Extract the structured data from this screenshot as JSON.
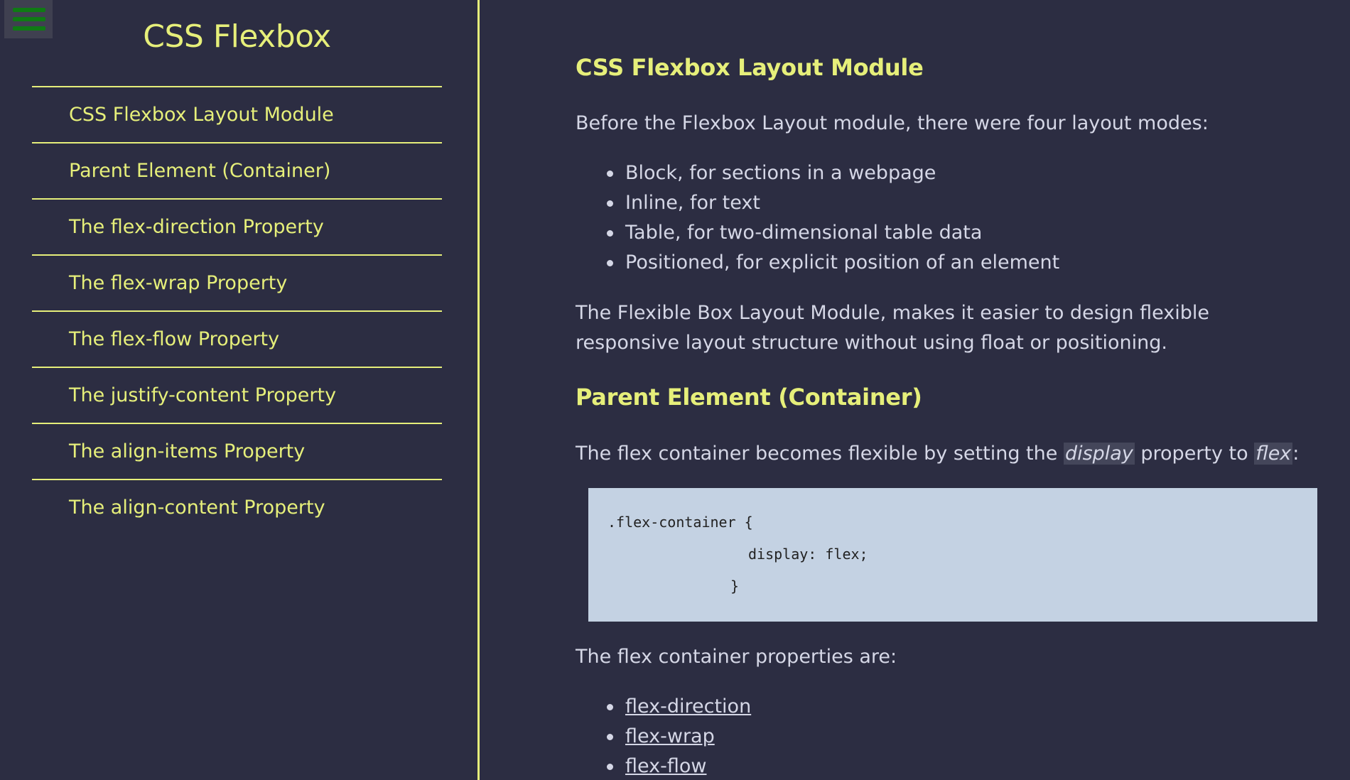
{
  "sidebar": {
    "title": "CSS Flexbox",
    "items": [
      {
        "label": "CSS Flexbox Layout Module"
      },
      {
        "label": "Parent Element (Container)"
      },
      {
        "label": "The flex-direction Property"
      },
      {
        "label": "The flex-wrap Property"
      },
      {
        "label": "The flex-flow Property"
      },
      {
        "label": "The justify-content Property"
      },
      {
        "label": "The align-items Property"
      },
      {
        "label": "The align-content Property"
      }
    ]
  },
  "main": {
    "section1": {
      "heading": "CSS Flexbox Layout Module",
      "intro": "Before the Flexbox Layout module, there were four layout modes:",
      "modes": [
        "Block, for sections in a webpage",
        "Inline, for text",
        "Table, for two-dimensional table data",
        "Positioned, for explicit position of an element"
      ],
      "summary": "The Flexible Box Layout Module, makes it easier to design flexible responsive layout structure without using float or positioning."
    },
    "section2": {
      "heading": "Parent Element (Container)",
      "sentence_before": "The flex container becomes flexible by setting the ",
      "keyword1": "display",
      "sentence_middle": " property to ",
      "keyword2": "flex",
      "sentence_after": ":",
      "code_lines": [
        ".flex-container {",
        "display: flex;",
        "}"
      ],
      "properties_intro": "The flex container properties are:",
      "property_links": [
        "flex-direction",
        "flex-wrap",
        "flex-flow"
      ]
    }
  },
  "colors": {
    "background": "#2c2d42",
    "accent": "#e6ef7a",
    "text": "#d5d7e6",
    "code_background": "#c4d2e3",
    "menu_icon": "#0f7a14"
  }
}
